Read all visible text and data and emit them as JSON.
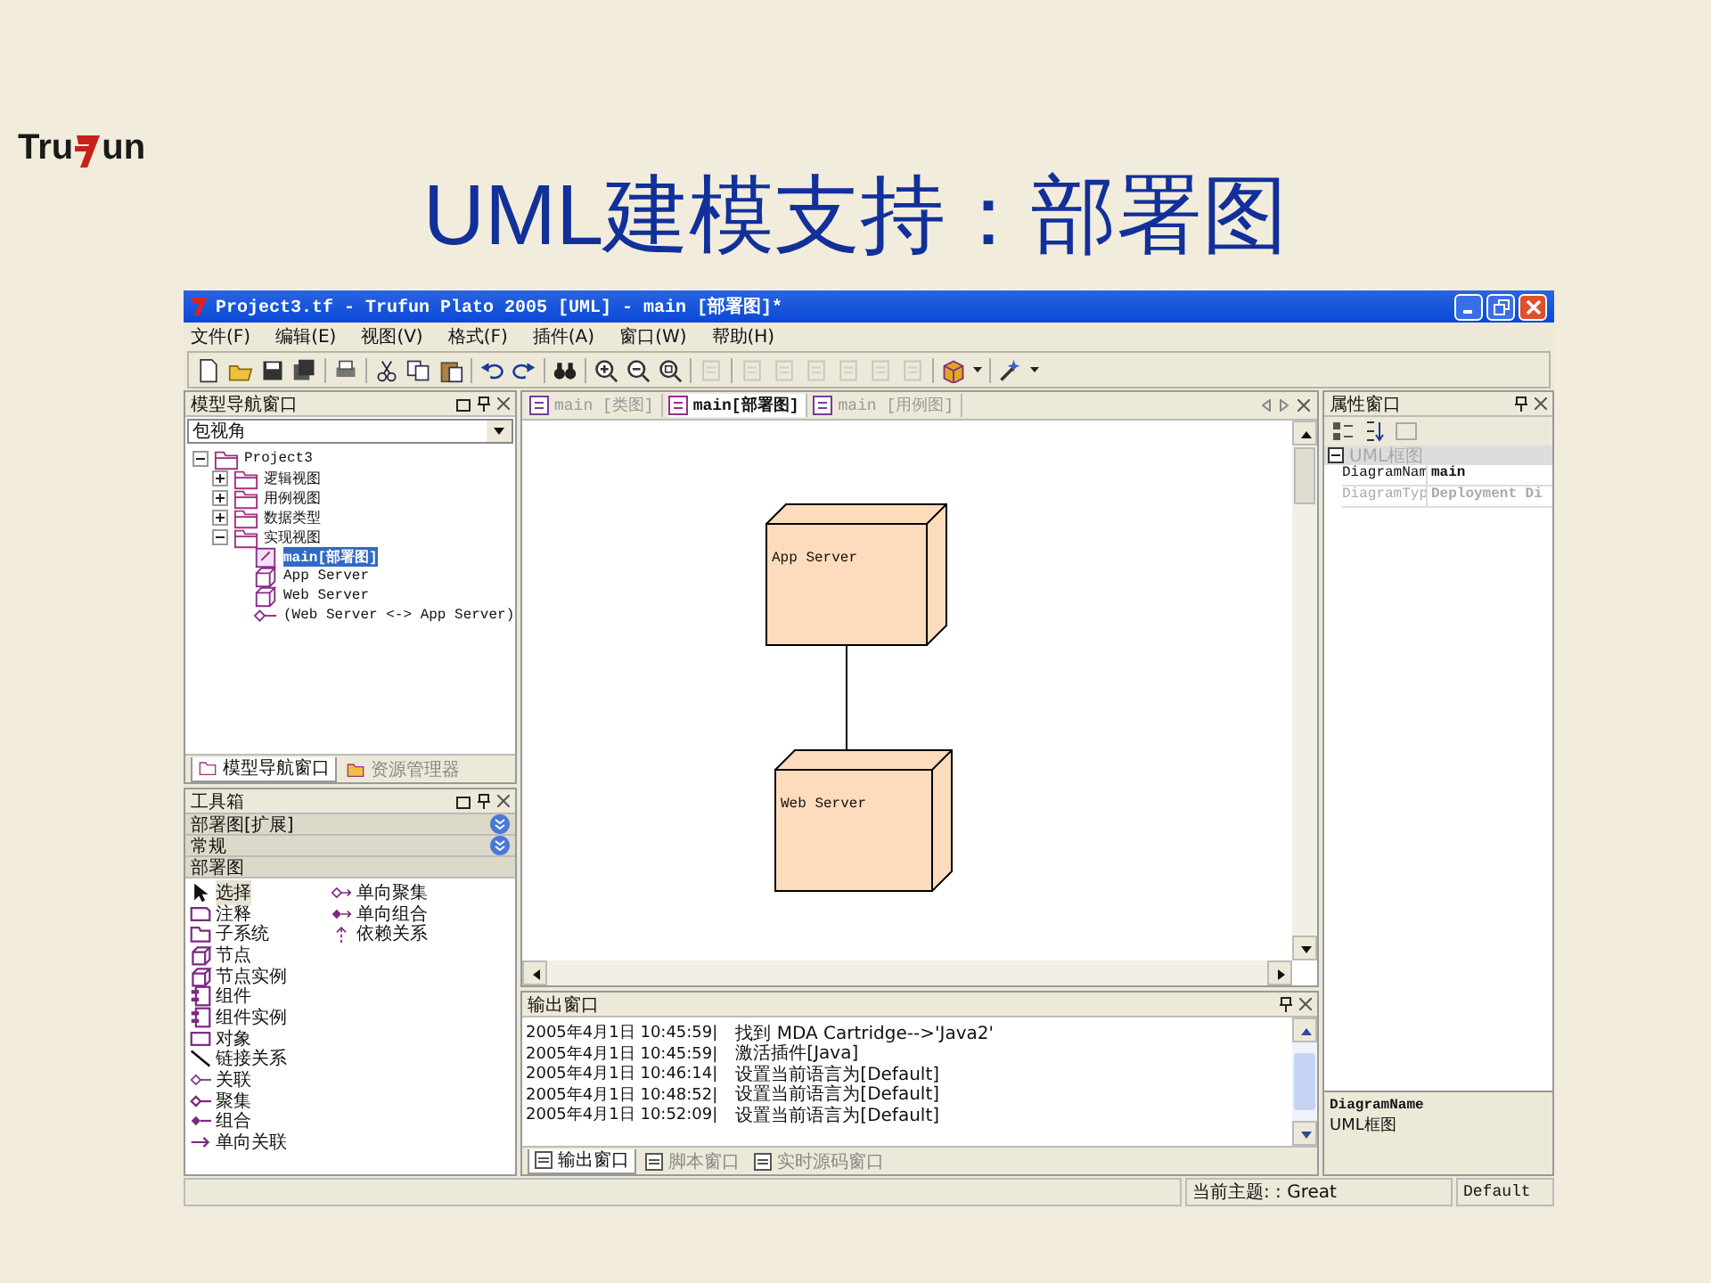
{
  "slide": {
    "logo": {
      "prefix": "Tru",
      "suffix": "un"
    },
    "title": "UML建模支持：部署图"
  },
  "window": {
    "title": "Project3.tf - Trufun Plato 2005 [UML] - main [部署图]*"
  },
  "menu": [
    "文件(F)",
    "编辑(E)",
    "视图(V)",
    "格式(F)",
    "插件(A)",
    "窗口(W)",
    "帮助(H)"
  ],
  "toolbar": [
    {
      "kind": "new",
      "disabled": false
    },
    {
      "kind": "open",
      "disabled": false
    },
    {
      "kind": "save",
      "disabled": false
    },
    {
      "kind": "save-all",
      "disabled": false
    },
    {
      "kind": "sep"
    },
    {
      "kind": "print",
      "disabled": false
    },
    {
      "kind": "sep"
    },
    {
      "kind": "cut",
      "disabled": false
    },
    {
      "kind": "copy",
      "disabled": false
    },
    {
      "kind": "paste",
      "disabled": false
    },
    {
      "kind": "sep"
    },
    {
      "kind": "undo",
      "disabled": false
    },
    {
      "kind": "redo",
      "disabled": false
    },
    {
      "kind": "sep"
    },
    {
      "kind": "find",
      "disabled": false
    },
    {
      "kind": "sep"
    },
    {
      "kind": "zoom-in",
      "disabled": false
    },
    {
      "kind": "zoom-out",
      "disabled": false
    },
    {
      "kind": "zoom-fit",
      "disabled": false
    },
    {
      "kind": "sep"
    },
    {
      "kind": "page",
      "disabled": true
    },
    {
      "kind": "sep"
    },
    {
      "kind": "page",
      "disabled": true
    },
    {
      "kind": "page",
      "disabled": true
    },
    {
      "kind": "page",
      "disabled": true
    },
    {
      "kind": "page",
      "disabled": true
    },
    {
      "kind": "page",
      "disabled": true
    },
    {
      "kind": "page",
      "disabled": true
    },
    {
      "kind": "sep"
    },
    {
      "kind": "package",
      "disabled": false
    },
    {
      "kind": "sep"
    },
    {
      "kind": "tools",
      "disabled": false
    }
  ],
  "nav_panel": {
    "title": "模型导航窗口",
    "view_select": "包视角",
    "tree": [
      {
        "label": "Project3",
        "kind": "folder",
        "expanded": true,
        "selected": false,
        "children": [
          {
            "label": "逻辑视图",
            "kind": "folder",
            "expanded": false,
            "selected": false
          },
          {
            "label": "用例视图",
            "kind": "folder",
            "expanded": false,
            "selected": false
          },
          {
            "label": "数据类型",
            "kind": "folder",
            "expanded": false,
            "selected": false
          },
          {
            "label": "实现视图",
            "kind": "folder",
            "expanded": true,
            "selected": false,
            "children": [
              {
                "label": "main[部署图]",
                "kind": "diagram",
                "selected": true
              },
              {
                "label": "App Server",
                "kind": "node",
                "selected": false
              },
              {
                "label": "Web Server",
                "kind": "node",
                "selected": false
              },
              {
                "label": "(Web Server <-> App Server)",
                "kind": "association",
                "selected": false
              }
            ]
          }
        ]
      }
    ],
    "tabs": [
      {
        "label": "模型导航窗口",
        "selected": true
      },
      {
        "label": "资源管理器",
        "selected": false
      }
    ]
  },
  "toolbox": {
    "title": "工具箱",
    "sections": [
      {
        "label": "部署图[扩展]",
        "expanded": false
      },
      {
        "label": "常规",
        "expanded": false
      },
      {
        "label": "部署图",
        "expanded": true,
        "tools": [
          {
            "label": "选择",
            "kind": "select",
            "selected": true
          },
          {
            "label": "注释",
            "kind": "note",
            "selected": false
          },
          {
            "label": "子系统",
            "kind": "subsystem",
            "selected": false
          },
          {
            "label": "节点",
            "kind": "node",
            "selected": false
          },
          {
            "label": "节点实例",
            "kind": "node",
            "selected": false
          },
          {
            "label": "组件",
            "kind": "component",
            "selected": false
          },
          {
            "label": "组件实例",
            "kind": "component",
            "selected": false
          },
          {
            "label": "对象",
            "kind": "object",
            "selected": false
          },
          {
            "label": "链接关系",
            "kind": "link",
            "selected": false
          },
          {
            "label": "关联",
            "kind": "association",
            "selected": false
          },
          {
            "label": "聚集",
            "kind": "aggregation",
            "selected": false
          },
          {
            "label": "组合",
            "kind": "composition",
            "selected": false
          },
          {
            "label": "单向关联",
            "kind": "directed",
            "selected": false
          },
          {
            "label": "单向聚集",
            "kind": "directed-aggregation",
            "selected": false
          },
          {
            "label": "单向组合",
            "kind": "directed-composition",
            "selected": false
          },
          {
            "label": "依赖关系",
            "kind": "dependency",
            "selected": false
          }
        ]
      }
    ]
  },
  "doc_tabs": [
    {
      "label": "main [类图]",
      "kind": "class",
      "selected": false
    },
    {
      "label": "main[部署图]",
      "kind": "deployment",
      "selected": true
    },
    {
      "label": "main [用例图]",
      "kind": "usecase",
      "selected": false
    }
  ],
  "diagram": {
    "nodes": [
      {
        "label": "App Server"
      },
      {
        "label": "Web Server"
      }
    ]
  },
  "output": {
    "title": "输出窗口",
    "lines": [
      {
        "time": "2005年4月1日 10:45:59|",
        "message": "找到 MDA Cartridge-->'Java2'"
      },
      {
        "time": "2005年4月1日 10:45:59|",
        "message": "激活插件[Java]"
      },
      {
        "time": "2005年4月1日 10:46:14|",
        "message": "设置当前语言为[Default]"
      },
      {
        "time": "2005年4月1日 10:48:52|",
        "message": "设置当前语言为[Default]"
      },
      {
        "time": "2005年4月1日 10:52:09|",
        "message": "设置当前语言为[Default]"
      }
    ],
    "tabs": [
      {
        "label": "输出窗口",
        "selected": true
      },
      {
        "label": "脚本窗口",
        "selected": false
      },
      {
        "label": "实时源码窗口",
        "selected": false
      }
    ]
  },
  "properties": {
    "title": "属性窗口",
    "category": "UML框图",
    "rows": [
      {
        "name": "DiagramNam",
        "value": "main",
        "disabled": false
      },
      {
        "name": "DiagramTyp",
        "value": "Deployment Di",
        "disabled": true
      }
    ],
    "description": {
      "title": "DiagramName",
      "text": "UML框图"
    }
  },
  "status_bar": {
    "theme": "当前主题: : Great",
    "language": "Default"
  }
}
